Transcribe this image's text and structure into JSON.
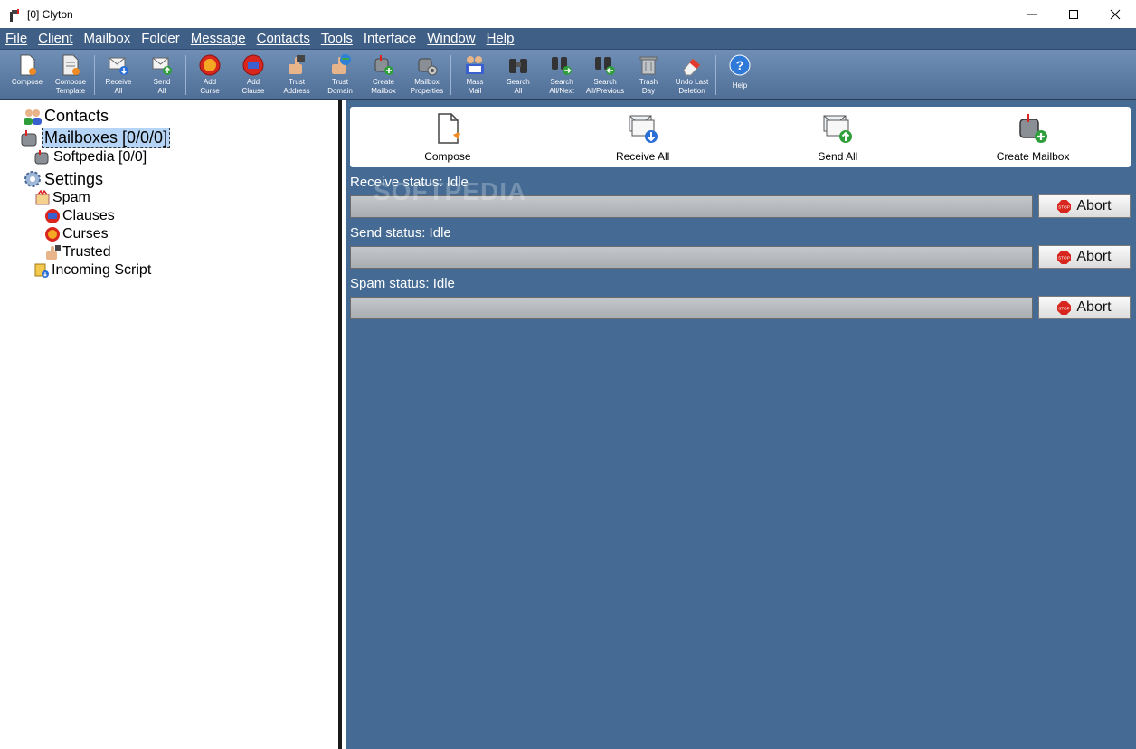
{
  "window": {
    "title": "[0] Clyton"
  },
  "menu": [
    "File",
    "Client",
    "Mailbox",
    "Folder",
    "Message",
    "Contacts",
    "Tools",
    "Interface",
    "Window",
    "Help"
  ],
  "toolbar": [
    {
      "label": "Compose"
    },
    {
      "label": "Compose\nTemplate"
    },
    {
      "label": "Receive\nAll"
    },
    {
      "label": "Send\nAll"
    },
    {
      "label": "Add\nCurse"
    },
    {
      "label": "Add\nClause"
    },
    {
      "label": "Trust\nAddress"
    },
    {
      "label": "Trust\nDomain"
    },
    {
      "label": "Create\nMailbox"
    },
    {
      "label": "Mailbox\nProperties"
    },
    {
      "label": "Mass\nMail"
    },
    {
      "label": "Search\nAll"
    },
    {
      "label": "Search\nAll/Next"
    },
    {
      "label": "Search\nAll/Previous"
    },
    {
      "label": "Trash\nDay"
    },
    {
      "label": "Undo Last\nDeletion"
    },
    {
      "label": "Help"
    }
  ],
  "tree": {
    "contacts": "Contacts",
    "mailboxes": "Mailboxes [0/0/0]",
    "softpedia": "Softpedia [0/0]",
    "settings": "Settings",
    "spam": "Spam",
    "clauses": "Clauses",
    "curses": "Curses",
    "trusted": "Trusted",
    "incoming_script": "Incoming Script"
  },
  "quick": {
    "compose": "Compose",
    "receive_all": "Receive All",
    "send_all": "Send All",
    "create_mailbox": "Create Mailbox"
  },
  "status": {
    "receive": "Receive status: Idle",
    "send": "Send status: Idle",
    "spam": "Spam status: Idle",
    "abort": "Abort"
  },
  "watermark": "SOFTPEDIA"
}
